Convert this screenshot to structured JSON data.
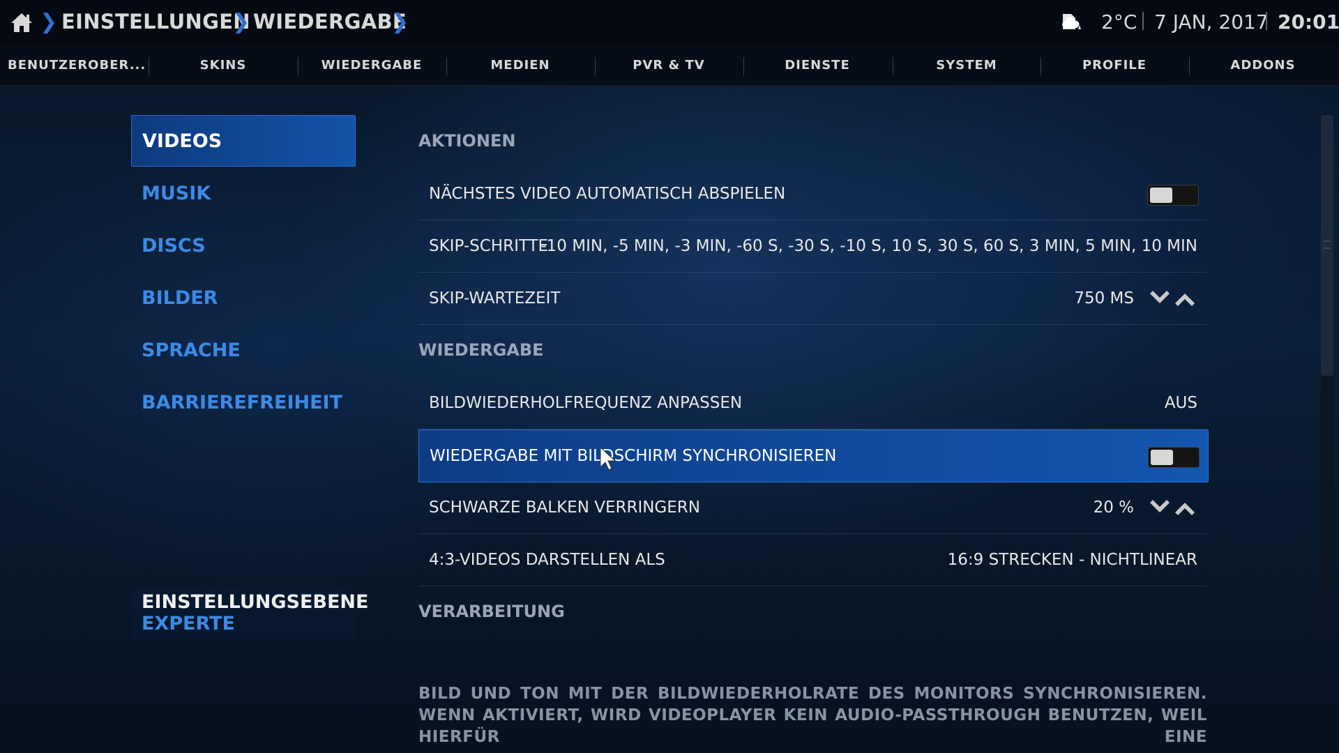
{
  "header": {
    "breadcrumbs": [
      "EINSTELLUNGEN",
      "WIEDERGABE"
    ],
    "home_icon": "home-icon",
    "weather_icon": "weather-cloudy-icon",
    "temperature": "2°C",
    "date": "7 JAN, 2017",
    "time": "20:01"
  },
  "tabs": [
    "BENUTZEROBER...",
    "SKINS",
    "WIEDERGABE",
    "MEDIEN",
    "PVR & TV",
    "DIENSTE",
    "SYSTEM",
    "PROFILE",
    "ADDONS"
  ],
  "sidebar": {
    "items": [
      {
        "label": "VIDEOS",
        "active": true
      },
      {
        "label": "MUSIK"
      },
      {
        "label": "DISCS"
      },
      {
        "label": "BILDER"
      },
      {
        "label": "SPRACHE"
      },
      {
        "label": "BARRIEREFREIHEIT"
      }
    ],
    "level_title": "EINSTELLUNGSEBENE",
    "level_value": "EXPERTE"
  },
  "settings": {
    "groups": [
      "AKTIONEN",
      "WIEDERGABE",
      "VERARBEITUNG"
    ],
    "rows": [
      {
        "label": "NÄCHSTES VIDEO AUTOMATISCH ABSPIELEN",
        "type": "toggle",
        "enabled": false
      },
      {
        "label": "SKIP-SCHRITTE",
        "value": "-10 MIN, -5 MIN, -3 MIN, -60 S, -30 S, -10 S, 10 S, 30 S, 60 S, 3 MIN, 5 MIN, 10 MIN"
      },
      {
        "label": "SKIP-WARTEZEIT",
        "value": "750 MS",
        "type": "spinner"
      },
      {
        "label": "BILDWIEDERHOLFREQUENZ ANPASSEN",
        "value": "AUS"
      },
      {
        "label": "WIEDERGABE MIT BILDSCHIRM SYNCHRONISIEREN",
        "type": "toggle",
        "enabled": false,
        "focused": true
      },
      {
        "label": "SCHWARZE BALKEN VERRINGERN",
        "value": "20 %",
        "type": "spinner"
      },
      {
        "label": "4:3-VIDEOS DARSTELLEN ALS",
        "value": "16:9 STRECKEN - NICHTLINEAR"
      }
    ]
  },
  "description": "BILD UND TON MIT DER BILDWIEDERHOLRATE DES MONITORS SYNCHRONISIEREN. WENN AKTIVIERT, WIRD VIDEOPLAYER KEIN AUDIO-PASSTHROUGH BENUTZEN, WEIL HIERFÜR EINE",
  "colors": {
    "accent": "#1456b0",
    "accent_text": "#3b8ae6",
    "background": "#0a1e36"
  }
}
